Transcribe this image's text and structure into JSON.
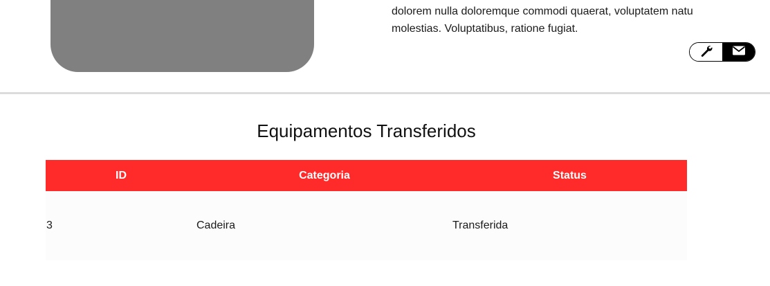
{
  "profile": {
    "description_lines": [
      "dolorem nulla doloremque commodi quaerat, voluptatem natu",
      "molestias. Voluptatibus, ratione fugiat."
    ],
    "actions": [
      {
        "icon": "wrench-icon"
      },
      {
        "icon": "envelope-icon"
      }
    ]
  },
  "section": {
    "title": "Equipamentos Transferidos"
  },
  "table": {
    "headers": [
      "ID",
      "Categoria",
      "Status"
    ],
    "rows": [
      [
        "3",
        "Cadeira",
        "Transferida"
      ]
    ]
  },
  "colors": {
    "header_bg": "#ff2a2a",
    "placeholder": "#808080",
    "divider": "#dcdcdc"
  }
}
